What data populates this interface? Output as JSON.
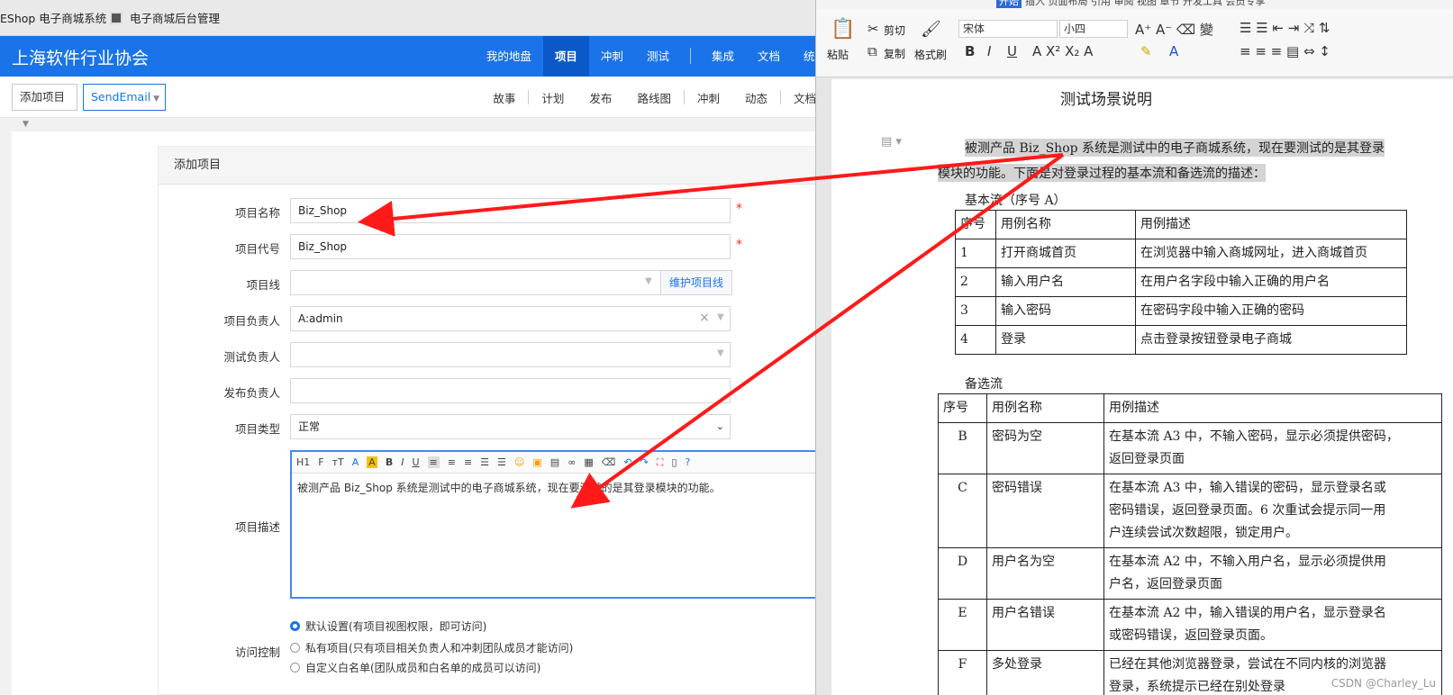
{
  "browser": {
    "tabs": [
      {
        "label": "EShop 电子商城系统"
      },
      {
        "label": "电子商城后台管理"
      }
    ]
  },
  "app": {
    "brand": "上海软件行业协会",
    "nav": [
      "我的地盘",
      "项目",
      "冲刺",
      "测试",
      "集成",
      "文档",
      "统计"
    ],
    "active_nav": "项目",
    "breadcrumb": {
      "item1": "添加项目",
      "item2": "SendEmail"
    },
    "subnav": [
      "故事",
      "计划",
      "发布",
      "路线图",
      "冲刺",
      "动态",
      "文档"
    ]
  },
  "form": {
    "title": "添加项目",
    "labels": {
      "name": "项目名称",
      "code": "项目代号",
      "line": "项目线",
      "owner": "项目负责人",
      "tester": "测试负责人",
      "releaser": "发布负责人",
      "type": "项目类型",
      "desc": "项目描述",
      "acl": "访问控制"
    },
    "values": {
      "name": "Biz_Shop",
      "code": "Biz_Shop",
      "line": "",
      "owner": "A:admin",
      "tester": "",
      "releaser": "",
      "type": "正常"
    },
    "required_mark": "*",
    "line_button": "维护项目线",
    "editor_toolbar": [
      "H1",
      "F",
      "тT",
      "A",
      "A",
      "B",
      "I",
      "U"
    ],
    "description": "被测产品 Biz_Shop 系统是测试中的电子商城系统，现在要测试的是其登录模块的功能。",
    "acl_options": [
      {
        "label": "默认设置(有项目视图权限，即可访问)",
        "checked": true
      },
      {
        "label": "私有项目(只有项目相关负责人和冲刺团队成员才能访问)",
        "checked": false
      },
      {
        "label": "自定义白名单(团队成员和白名单的成员可以访问)",
        "checked": false
      }
    ]
  },
  "word": {
    "menu": {
      "start": "开始",
      "rest": "插入 页面布局 引用 审阅 视图 章节 开发工具 会员专享"
    },
    "ribbon": {
      "paste": "粘贴",
      "cut": "剪切",
      "copy": "复制",
      "format_painter": "格式刷",
      "font": "宋体",
      "size": "小四"
    },
    "title": "测试场景说明",
    "intro_line1": "被测产品 Biz_Shop 系统是测试中的电子商城系统，现在要测试的是其登录",
    "intro_line2": "模块的功能。下面是对登录过程的基本流和备选流的描述：",
    "basic_flow_title": "基本流（序号 A）",
    "basic_headers": [
      "序号",
      "用例名称",
      "用例描述"
    ],
    "basic_rows": [
      [
        "1",
        "打开商城首页",
        "在浏览器中输入商城网址，进入商城首页"
      ],
      [
        "2",
        "输入用户名",
        "在用户名字段中输入正确的用户名"
      ],
      [
        "3",
        "输入密码",
        "在密码字段中输入正确的密码"
      ],
      [
        "4",
        "登录",
        "点击登录按钮登录电子商城"
      ]
    ],
    "alt_flow_title": "备选流",
    "alt_headers": [
      "序号",
      "用例名称",
      "用例描述"
    ],
    "alt_rows": [
      {
        "no": "B",
        "name": "密码为空",
        "desc": [
          "在基本流 A3 中，不输入密码，显示必须提供密码，",
          "返回登录页面"
        ]
      },
      {
        "no": "C",
        "name": "密码错误",
        "desc": [
          "在基本流 A3 中，输入错误的密码，显示登录名或",
          "密码错误，返回登录页面。6 次重试会提示同一用",
          "户连续尝试次数超限，锁定用户。"
        ]
      },
      {
        "no": "D",
        "name": "用户名为空",
        "desc": [
          "在基本流 A2 中，不输入用户名，显示必须提供用",
          "户名，返回登录页面"
        ]
      },
      {
        "no": "E",
        "name": "用户名错误",
        "desc": [
          "在基本流 A2 中，输入错误的用户名，显示登录名",
          "或密码错误，返回登录页面。"
        ]
      },
      {
        "no": "F",
        "name": "多处登录",
        "desc": [
          "已经在其他浏览器登录，尝试在不同内核的浏览器",
          "登录，系统提示已经在别处登录"
        ]
      }
    ],
    "watermark": "CSDN @Charley_Lu"
  },
  "annotation_color": "#ff1a1a"
}
